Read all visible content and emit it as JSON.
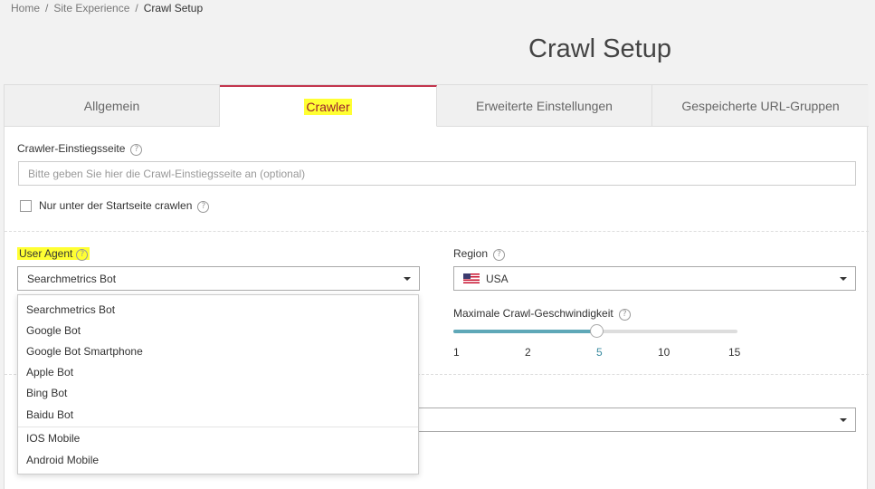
{
  "breadcrumb": {
    "home": "Home",
    "section": "Site Experience",
    "current": "Crawl Setup",
    "separator": "/"
  },
  "page_title": "Crawl Setup",
  "tabs": [
    {
      "label": "Allgemein",
      "active": false
    },
    {
      "label": "Crawler",
      "active": true
    },
    {
      "label": "Erweiterte Einstellungen",
      "active": false
    },
    {
      "label": "Gespeicherte URL-Gruppen",
      "active": false
    }
  ],
  "crawler": {
    "entry_label": "Crawler-Einstiegsseite",
    "entry_placeholder": "Bitte geben Sie hier die Crawl-Einstiegsseite an (optional)",
    "checkbox_label": "Nur unter der Startseite crawlen",
    "user_agent_label": "User Agent",
    "user_agent_value": "Searchmetrics Bot",
    "region_label": "Region",
    "region_value": "USA",
    "speed_label": "Maximale Crawl-Geschwindigkeit",
    "speed_ticks": [
      "1",
      "2",
      "5",
      "10",
      "15"
    ],
    "speed_value": "5",
    "help_glyph": "?"
  },
  "user_agent_options": [
    "Searchmetrics Bot",
    "Google Bot",
    "Google Bot Smartphone",
    "Apple Bot",
    "Bing Bot",
    "Baidu Bot",
    "IOS Mobile",
    "Android Mobile"
  ],
  "colors": {
    "accent": "#c3354d",
    "highlight": "#ffff33",
    "slider": "#5fa8b8"
  }
}
